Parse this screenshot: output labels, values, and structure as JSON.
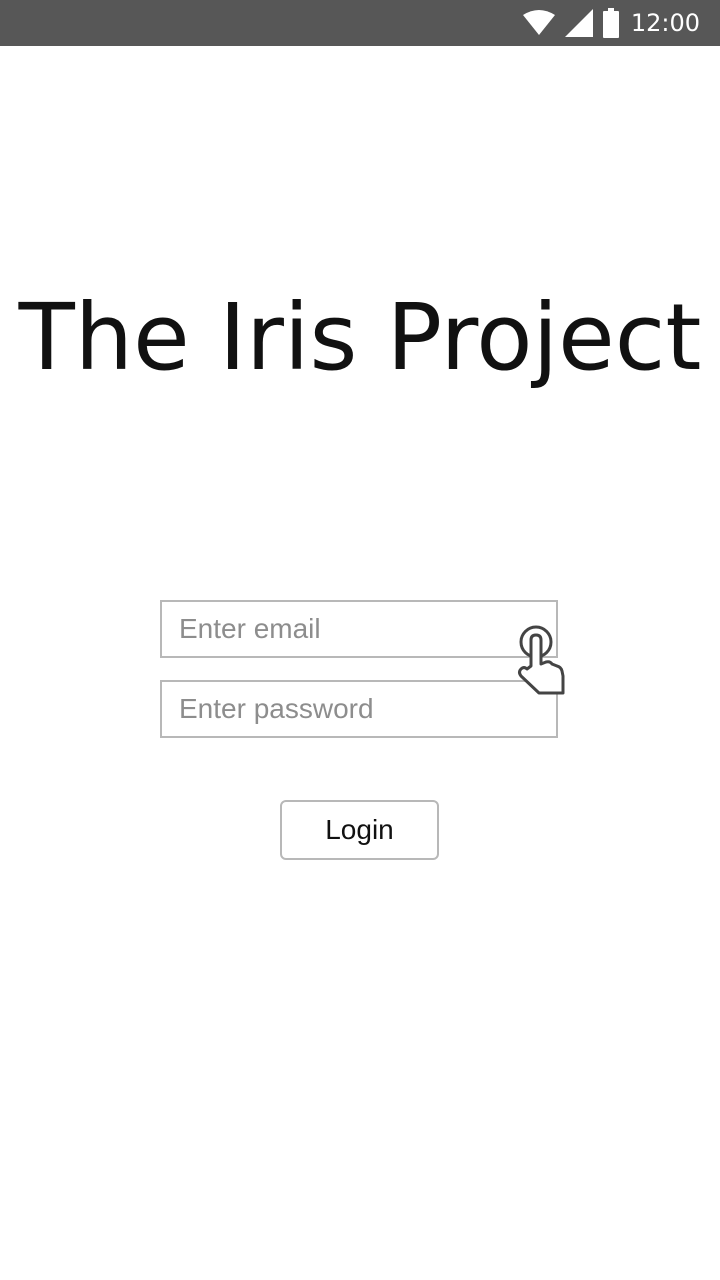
{
  "status_bar": {
    "time": "12:00",
    "icons": [
      "wifi-icon",
      "cellular-signal-icon",
      "battery-icon"
    ],
    "background": "#575757"
  },
  "app": {
    "title": "The Iris Project"
  },
  "login_form": {
    "email_placeholder": "Enter email",
    "email_value": "",
    "password_placeholder": "Enter password",
    "password_value": "",
    "login_label": "Login",
    "border_color": "#b8b8b8"
  },
  "overlay": {
    "icon": "tap-hand-icon"
  }
}
